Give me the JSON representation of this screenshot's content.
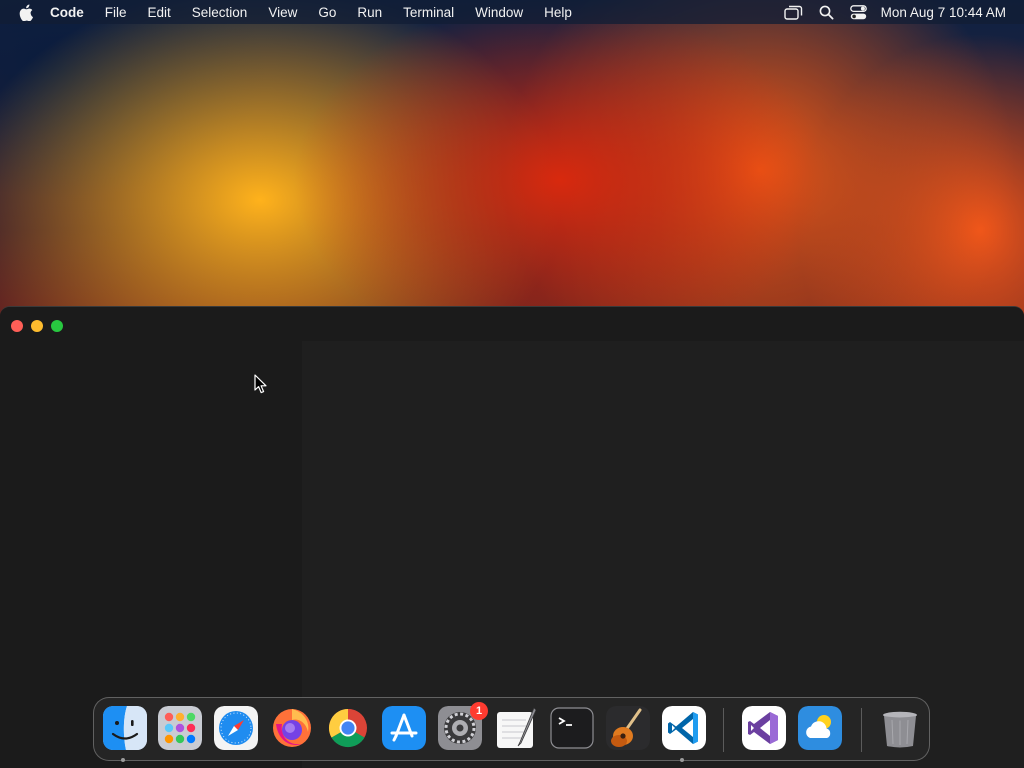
{
  "menubar": {
    "apple_icon": "apple-logo-icon",
    "app_name": "Code",
    "items": [
      "File",
      "Edit",
      "Selection",
      "View",
      "Go",
      "Run",
      "Terminal",
      "Window",
      "Help"
    ],
    "status_icons": [
      "screen-mirroring-icon",
      "search-icon",
      "control-center-icon"
    ],
    "clock": "Mon Aug 7  10:44 AM"
  },
  "window": {
    "traffic_lights": [
      "close",
      "minimize",
      "zoom"
    ]
  },
  "dock": {
    "apps": [
      {
        "name": "Finder",
        "icon": "finder-icon",
        "running": true
      },
      {
        "name": "Launchpad",
        "icon": "launchpad-icon",
        "running": false
      },
      {
        "name": "Safari",
        "icon": "safari-icon",
        "running": false
      },
      {
        "name": "Firefox",
        "icon": "firefox-icon",
        "running": false
      },
      {
        "name": "Google Chrome",
        "icon": "chrome-icon",
        "running": false
      },
      {
        "name": "App Store",
        "icon": "app-store-icon",
        "running": false
      },
      {
        "name": "System Settings",
        "icon": "system-settings-icon",
        "running": false,
        "badge": "1"
      },
      {
        "name": "TextEdit",
        "icon": "textedit-icon",
        "running": false
      },
      {
        "name": "Terminal",
        "icon": "terminal-icon",
        "running": false
      },
      {
        "name": "GarageBand",
        "icon": "garageband-icon",
        "running": false
      },
      {
        "name": "Visual Studio Code",
        "icon": "vscode-icon",
        "running": true
      },
      {
        "name": "Visual Studio",
        "icon": "visual-studio-icon",
        "running": false
      },
      {
        "name": "Weather",
        "icon": "weather-icon",
        "running": false
      },
      {
        "name": "Trash",
        "icon": "trash-icon",
        "running": false
      }
    ]
  },
  "colors": {
    "close": "#ff5f57",
    "minimize": "#febc2e",
    "zoom": "#28c840",
    "window_bg": "#1f1f1f",
    "sidebar_bg": "#1b1b1b",
    "badge": "#ff3b30"
  }
}
